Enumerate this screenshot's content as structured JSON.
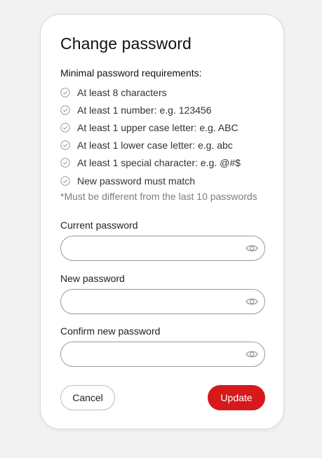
{
  "dialog": {
    "title": "Change password",
    "requirements_heading": "Minimal password requirements:",
    "requirements": [
      "At least 8 characters",
      "At least 1 number: e.g. 123456",
      "At least 1 upper case letter: e.g. ABC",
      "At least 1 lower case letter: e.g. abc",
      "At least 1 special character: e.g. @#$",
      "New password must match"
    ],
    "note": "*Must be different from the last 10 passwords",
    "fields": [
      {
        "label": "Current password",
        "value": "",
        "placeholder": ""
      },
      {
        "label": "New password",
        "value": "",
        "placeholder": ""
      },
      {
        "label": "Confirm new password",
        "value": "",
        "placeholder": ""
      }
    ],
    "cancel_label": "Cancel",
    "update_label": "Update"
  },
  "colors": {
    "page_background": "#f2f2f2",
    "card_background": "#ffffff",
    "primary_button": "#d7191c",
    "check_icon": "#9a9a9a",
    "note_text": "#7d7d7d"
  },
  "icons": {
    "requirement_check": "check-circle-icon",
    "password_visibility": "eye-icon"
  }
}
